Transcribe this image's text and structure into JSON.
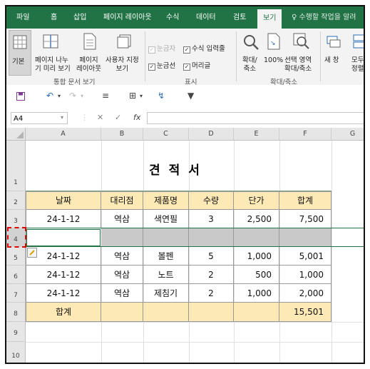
{
  "ribbon_tabs": [
    "파일",
    "홈",
    "삽입",
    "페이지 레이아웃",
    "수식",
    "데이터",
    "검토",
    "보기",
    "수행할 작업을 알려"
  ],
  "active_tab": "보기",
  "workbook_views": {
    "normal": "기본",
    "page_break_1": "페이지 나누",
    "page_break_2": "기 미리 보기",
    "page_layout_1": "페이지",
    "page_layout_2": "레이아웃",
    "custom_1": "사용자 지정",
    "custom_2": "보기",
    "group_label": "통합 문서 보기"
  },
  "show": {
    "ruler": "눈금자",
    "formula_bar": "수식 입력줄",
    "gridlines": "눈금선",
    "headings": "머리글",
    "group_label": "표시"
  },
  "zoom": {
    "zoom_1": "확대/",
    "zoom_2": "축소",
    "hundred": "100%",
    "selection_1": "선택 영역",
    "selection_2": "확대/축소",
    "group_label": "확대/축소"
  },
  "window": {
    "new_window_1": "새 창",
    "arrange_1": "모두",
    "arrange_2": "정렬"
  },
  "name_box": "A4",
  "fx_label": "fx",
  "columns": [
    "A",
    "B",
    "C",
    "D",
    "E",
    "F",
    "G"
  ],
  "rows": [
    "1",
    "2",
    "3",
    "4",
    "5",
    "6",
    "7",
    "8",
    "9",
    "10"
  ],
  "sheet": {
    "title": "견적서",
    "headers": [
      "날짜",
      "대리점",
      "제품명",
      "수량",
      "단가",
      "합계"
    ],
    "row3": [
      "24-1-12",
      "역삼",
      "색연필",
      "3",
      "2,500",
      "7,500"
    ],
    "row5": [
      "24-1-12",
      "역삼",
      "볼펜",
      "5",
      "1,000",
      "5,001"
    ],
    "row6": [
      "24-1-12",
      "역삼",
      "노트",
      "2",
      "500",
      "1,000"
    ],
    "row7": [
      "24-1-12",
      "역삼",
      "제침기",
      "2",
      "1,000",
      "2,000"
    ],
    "total_label": "합계",
    "total_value": "15,501"
  },
  "colors": {
    "excel_green": "#217346",
    "header_fill": "#fde9b5",
    "gray_fill": "#c9c9c9",
    "selection_dash": "#e00000"
  }
}
